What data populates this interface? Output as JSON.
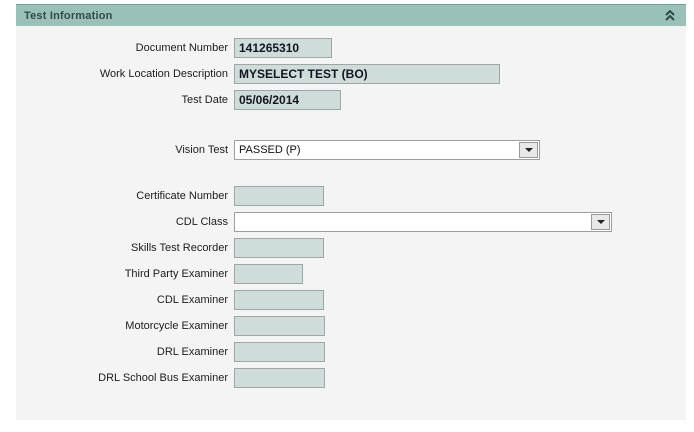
{
  "panel": {
    "title": "Test Information",
    "collapse_icon": "chevron-double-up-icon"
  },
  "colors": {
    "header_bg": "#9ac1b7",
    "header_border": "#72a198",
    "header_text": "#33494e",
    "body_bg": "#f4f4f5",
    "field_bg": "#cfddda",
    "field_border": "#a0a6a6",
    "value_text": "#121420",
    "combo_bg": "#ffffff"
  },
  "fields": [
    {
      "label": "Document Number",
      "value": "141265310",
      "type": "text"
    },
    {
      "label": "Work Location Description",
      "value": "MYSELECT TEST (BO)",
      "type": "text"
    },
    {
      "label": "Test Date",
      "value": "05/06/2014",
      "type": "text"
    },
    {
      "label": "Vision Test",
      "value": "PASSED (P)",
      "type": "dropdown"
    },
    {
      "label": "Certificate Number",
      "value": "",
      "type": "text"
    },
    {
      "label": "CDL Class",
      "value": "",
      "type": "dropdown"
    },
    {
      "label": "Skills Test Recorder",
      "value": "",
      "type": "text"
    },
    {
      "label": "Third Party Examiner",
      "value": "",
      "type": "text"
    },
    {
      "label": "CDL Examiner",
      "value": "",
      "type": "text"
    },
    {
      "label": "Motorcycle Examiner",
      "value": "",
      "type": "text"
    },
    {
      "label": "DRL Examiner",
      "value": "",
      "type": "text"
    },
    {
      "label": "DRL School Bus Examiner",
      "value": "",
      "type": "text"
    }
  ]
}
